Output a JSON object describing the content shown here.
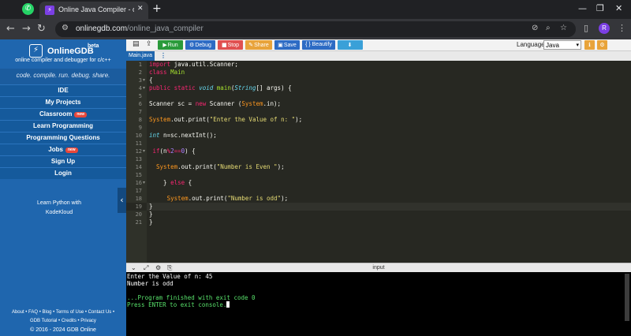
{
  "browser": {
    "tab_title": "Online Java Compiler - online e",
    "tab_close": "✕",
    "new_tab": "+",
    "url_host": "onlinegdb.com",
    "url_path": "/online_java_compiler",
    "avatar_letter": "R",
    "win_minimize": "—",
    "win_restore": "❐",
    "win_close": "✕"
  },
  "sidebar": {
    "brand": "OnlineGDB",
    "brand_beta": "beta",
    "brand_sub": "online compiler and debugger for c/c++",
    "motto": "code. compile. run. debug. share.",
    "items": [
      {
        "label": "IDE",
        "badge": ""
      },
      {
        "label": "My Projects",
        "badge": ""
      },
      {
        "label": "Classroom",
        "badge": "new"
      },
      {
        "label": "Learn Programming",
        "badge": ""
      },
      {
        "label": "Programming Questions",
        "badge": ""
      },
      {
        "label": "Jobs",
        "badge": "new"
      },
      {
        "label": "Sign Up",
        "badge": ""
      },
      {
        "label": "Login",
        "badge": ""
      }
    ],
    "promo_line1": "Learn Python with",
    "promo_line2": "KodeKloud",
    "footer_line1": "About • FAQ • Blog • Terms of Use • Contact Us •",
    "footer_line2": "GDB Tutorial • Credits • Privacy",
    "copyright": "© 2016 - 2024 GDB Online"
  },
  "ide_toolbar": {
    "run": "Run",
    "debug": "Debug",
    "stop": "Stop",
    "share": "Share",
    "save": "Save",
    "beautify": "{ } Beautify",
    "language_label": "Language",
    "language_value": "Java"
  },
  "file_tabs": {
    "active": "Main.java",
    "more": "⋮"
  },
  "editor": {
    "line_numbers": [
      "1",
      "2",
      "3",
      "4",
      "5",
      "6",
      "7",
      "8",
      "9",
      "10",
      "11",
      "12",
      "13",
      "14",
      "15",
      "16",
      "17",
      "18",
      "19",
      "20",
      "21"
    ]
  },
  "console": {
    "title": "input",
    "line1": "Enter the Value of n: 45",
    "line2": "Number is odd",
    "line3": "...Program finished with exit code 0",
    "line4": "Press ENTER to exit console."
  },
  "colors": {
    "sidebar_bg": "#1f66ae",
    "run": "#2a9a3a",
    "debug": "#2d6bc4",
    "stop": "#e05050",
    "share": "#e8a33a",
    "save": "#2d6bc4",
    "beautify": "#2d6bc4",
    "download": "#3aa0d8",
    "editor_bg": "#272822"
  }
}
